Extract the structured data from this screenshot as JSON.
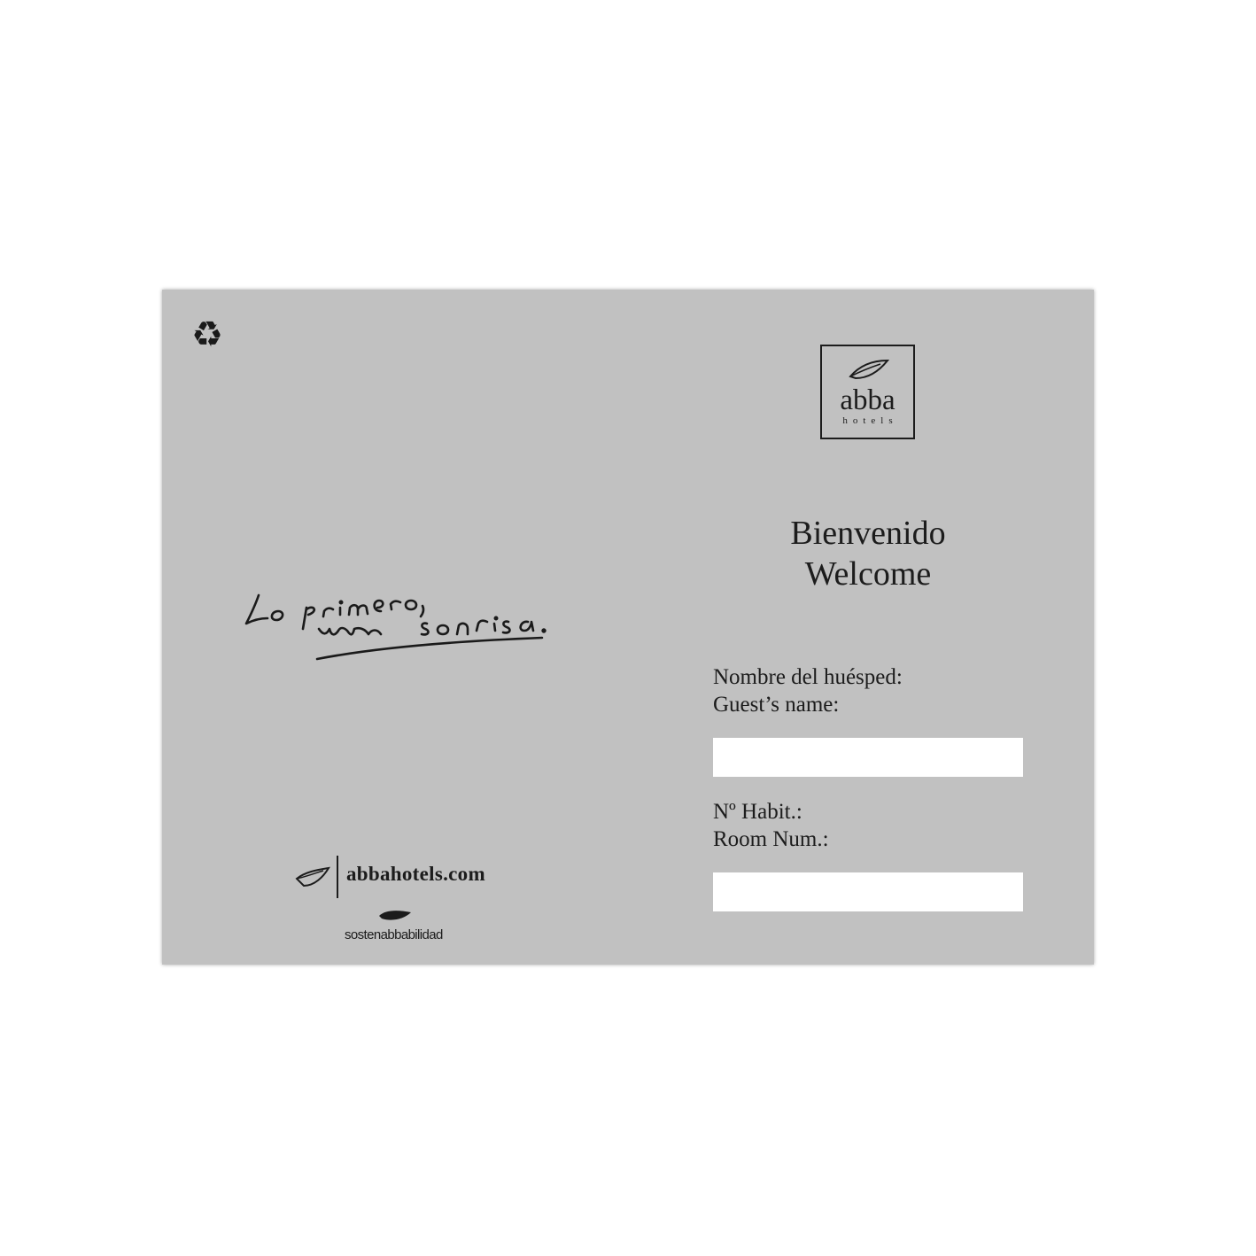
{
  "card": {
    "recycle_icon": "recycle-icon",
    "logo": {
      "word": "abba",
      "sub": "hotels",
      "icon": "leaf-icon"
    },
    "greeting": {
      "spanish": "Bienvenido",
      "english": "Welcome"
    },
    "guest": {
      "label_es": "Nombre del huésped:",
      "label_en": "Guest’s name:",
      "value": ""
    },
    "room": {
      "label_es": "Nº Habit.:",
      "label_en": "Room Num.:",
      "value": ""
    },
    "handwriting": {
      "line1": "Lo primero,",
      "line2": "una sonrisa."
    },
    "footer": {
      "url": "abbahotels.com",
      "sustainability": "sostenabbabilidad"
    }
  },
  "colors": {
    "card": "#c1c1c1",
    "ink": "#1c1c1c",
    "field": "#ffffff"
  }
}
